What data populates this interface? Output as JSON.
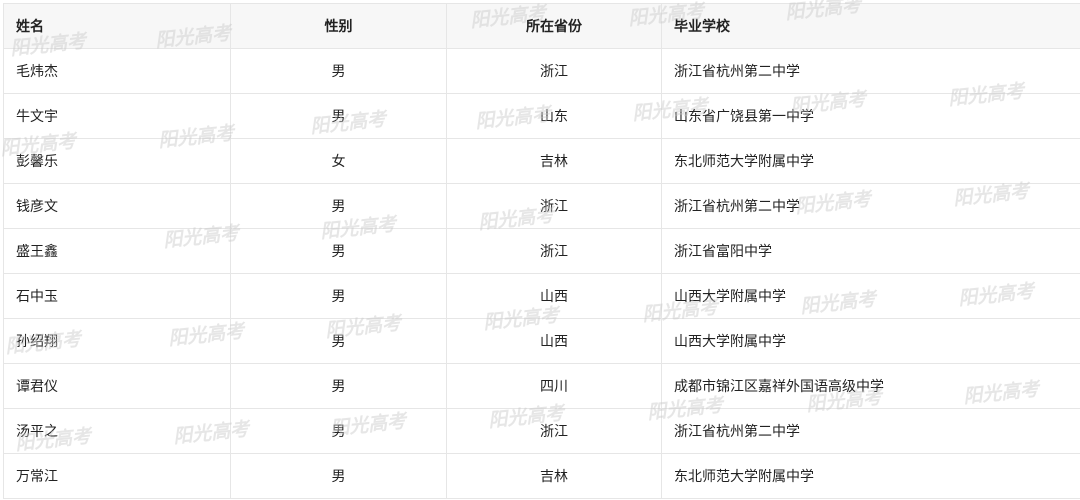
{
  "table": {
    "headers": [
      "姓名",
      "性别",
      "所在省份",
      "毕业学校"
    ],
    "rows": [
      [
        "毛炜杰",
        "男",
        "浙江",
        "浙江省杭州第二中学"
      ],
      [
        "牛文宇",
        "男",
        "山东",
        "山东省广饶县第一中学"
      ],
      [
        "彭馨乐",
        "女",
        "吉林",
        "东北师范大学附属中学"
      ],
      [
        "钱彦文",
        "男",
        "浙江",
        "浙江省杭州第二中学"
      ],
      [
        "盛王鑫",
        "男",
        "浙江",
        "浙江省富阳中学"
      ],
      [
        "石中玉",
        "男",
        "山西",
        "山西大学附属中学"
      ],
      [
        "孙绍翔",
        "男",
        "山西",
        "山西大学附属中学"
      ],
      [
        "谭君仪",
        "男",
        "四川",
        "成都市锦江区嘉祥外国语高级中学"
      ],
      [
        "汤平之",
        "男",
        "浙江",
        "浙江省杭州第二中学"
      ],
      [
        "万常江",
        "男",
        "吉林",
        "东北师范大学附属中学"
      ]
    ]
  },
  "watermark": {
    "text": "阳光高考",
    "color": "#c8c8c8"
  }
}
